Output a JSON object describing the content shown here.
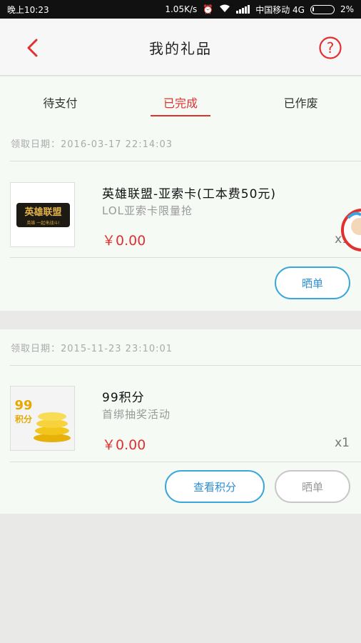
{
  "status_bar": {
    "time": "晚上10:23",
    "speed": "1.05K/s",
    "carrier": "中国移动 4G",
    "battery": "2%"
  },
  "header": {
    "title": "我的礼品"
  },
  "tabs": [
    {
      "label": "待支付",
      "active": false
    },
    {
      "label": "已完成",
      "active": true
    },
    {
      "label": "已作废",
      "active": false
    }
  ],
  "orders": [
    {
      "date": "领取日期：2016-03-17 22:14:03",
      "thumb_text": "英雄联盟",
      "thumb_subtext": "英雄 一起来战斗!",
      "name": "英雄联盟-亚索卡(工本费50元)",
      "description": "LOL亚索卡限量抢",
      "price": "￥0.00",
      "quantity": "x1",
      "buttons": {
        "share": "晒单"
      }
    },
    {
      "date": "领取日期：2015-11-23 23:10:01",
      "thumb_text": "99积分",
      "name": "99积分",
      "description": "首绑抽奖活动",
      "price": "￥0.00",
      "quantity": "x1",
      "buttons": {
        "view_points": "查看积分",
        "share": "晒单"
      }
    }
  ],
  "colors": {
    "accent": "#e0312f",
    "blue": "#3aa7dc",
    "card_bg": "#f5faf5",
    "page_bg": "#e9eae8"
  }
}
